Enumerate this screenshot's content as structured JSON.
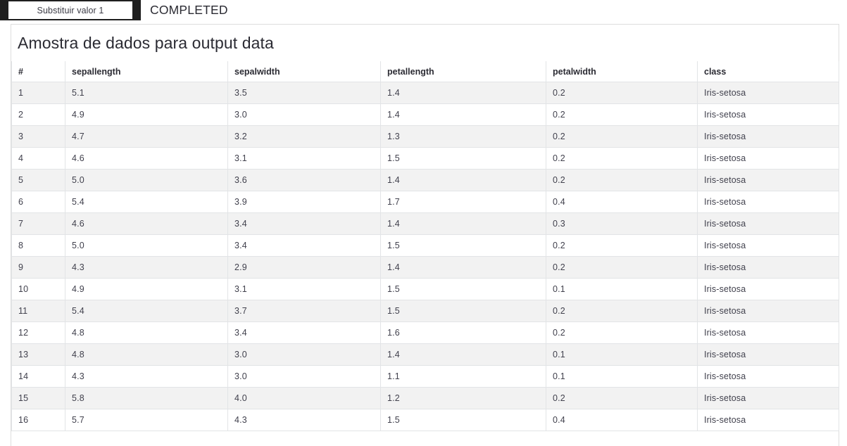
{
  "topbar": {
    "module_tab_label": "Substituir valor 1",
    "status_label": "COMPLETED"
  },
  "card": {
    "title": "Amostra de dados para output data"
  },
  "table": {
    "columns": [
      {
        "key": "index",
        "label": "#"
      },
      {
        "key": "sepallength",
        "label": "sepallength"
      },
      {
        "key": "sepalwidth",
        "label": "sepalwidth"
      },
      {
        "key": "petallength",
        "label": "petallength"
      },
      {
        "key": "petalwidth",
        "label": "petalwidth"
      },
      {
        "key": "class",
        "label": "class"
      }
    ],
    "rows": [
      {
        "index": "1",
        "sepallength": "5.1",
        "sepalwidth": "3.5",
        "petallength": "1.4",
        "petalwidth": "0.2",
        "class": "Iris-setosa"
      },
      {
        "index": "2",
        "sepallength": "4.9",
        "sepalwidth": "3.0",
        "petallength": "1.4",
        "petalwidth": "0.2",
        "class": "Iris-setosa"
      },
      {
        "index": "3",
        "sepallength": "4.7",
        "sepalwidth": "3.2",
        "petallength": "1.3",
        "petalwidth": "0.2",
        "class": "Iris-setosa"
      },
      {
        "index": "4",
        "sepallength": "4.6",
        "sepalwidth": "3.1",
        "petallength": "1.5",
        "petalwidth": "0.2",
        "class": "Iris-setosa"
      },
      {
        "index": "5",
        "sepallength": "5.0",
        "sepalwidth": "3.6",
        "petallength": "1.4",
        "petalwidth": "0.2",
        "class": "Iris-setosa"
      },
      {
        "index": "6",
        "sepallength": "5.4",
        "sepalwidth": "3.9",
        "petallength": "1.7",
        "petalwidth": "0.4",
        "class": "Iris-setosa"
      },
      {
        "index": "7",
        "sepallength": "4.6",
        "sepalwidth": "3.4",
        "petallength": "1.4",
        "petalwidth": "0.3",
        "class": "Iris-setosa"
      },
      {
        "index": "8",
        "sepallength": "5.0",
        "sepalwidth": "3.4",
        "petallength": "1.5",
        "petalwidth": "0.2",
        "class": "Iris-setosa"
      },
      {
        "index": "9",
        "sepallength": "4.3",
        "sepalwidth": "2.9",
        "petallength": "1.4",
        "petalwidth": "0.2",
        "class": "Iris-setosa"
      },
      {
        "index": "10",
        "sepallength": "4.9",
        "sepalwidth": "3.1",
        "petallength": "1.5",
        "petalwidth": "0.1",
        "class": "Iris-setosa"
      },
      {
        "index": "11",
        "sepallength": "5.4",
        "sepalwidth": "3.7",
        "petallength": "1.5",
        "petalwidth": "0.2",
        "class": "Iris-setosa"
      },
      {
        "index": "12",
        "sepallength": "4.8",
        "sepalwidth": "3.4",
        "petallength": "1.6",
        "petalwidth": "0.2",
        "class": "Iris-setosa"
      },
      {
        "index": "13",
        "sepallength": "4.8",
        "sepalwidth": "3.0",
        "petallength": "1.4",
        "petalwidth": "0.1",
        "class": "Iris-setosa"
      },
      {
        "index": "14",
        "sepallength": "4.3",
        "sepalwidth": "3.0",
        "petallength": "1.1",
        "petalwidth": "0.1",
        "class": "Iris-setosa"
      },
      {
        "index": "15",
        "sepallength": "5.8",
        "sepalwidth": "4.0",
        "petallength": "1.2",
        "petalwidth": "0.2",
        "class": "Iris-setosa"
      },
      {
        "index": "16",
        "sepallength": "5.7",
        "sepalwidth": "4.3",
        "petallength": "1.5",
        "petalwidth": "0.4",
        "class": "Iris-setosa"
      }
    ]
  },
  "colors": {
    "tab_border": "#1f1f1f",
    "card_border": "#dedede",
    "row_stripe": "#f2f2f2",
    "text_primary": "#2b2b33",
    "text_cell": "#41414d"
  }
}
